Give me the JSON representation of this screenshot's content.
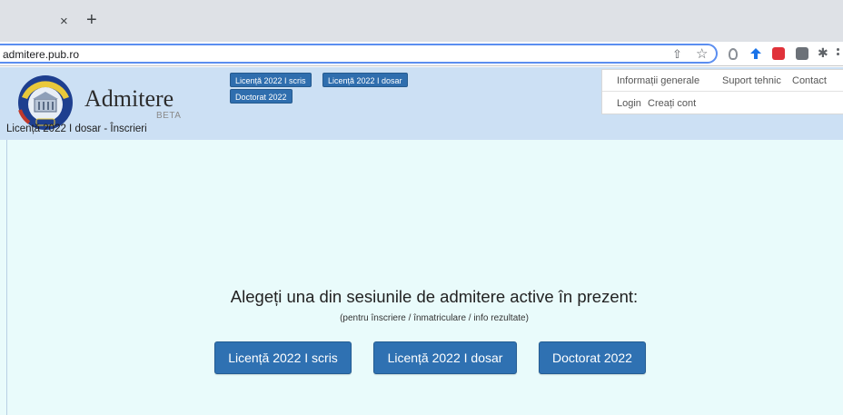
{
  "browser": {
    "tab_close": "×",
    "new_tab": "+",
    "url": "admitere.pub.ro",
    "share_glyph": "⇧",
    "bookmark_glyph": "☆",
    "extensions_glyph": "✱"
  },
  "header": {
    "brand_title": "Admitere",
    "brand_beta": "BETA",
    "breadcrumb": "Licență 2022 I dosar - Înscrieri",
    "session_pills": [
      "Licență 2022 I scris",
      "Licență 2022 I dosar",
      "Doctorat 2022"
    ],
    "nav_top": [
      "Informații generale",
      "Suport tehnic",
      "Contact"
    ],
    "nav_bottom": [
      "Login",
      "Creați cont"
    ]
  },
  "main": {
    "headline": "Alegeți una din sesiunile de admitere active în prezent:",
    "subline": "(pentru înscriere / înmatriculare / info rezultate)",
    "buttons": [
      "Licență 2022 I scris",
      "Licență 2022 I dosar",
      "Doctorat 2022"
    ]
  },
  "colors": {
    "header_bg": "#cce0f4",
    "page_bg": "#e9fbfb",
    "button_blue": "#2f71b2"
  }
}
